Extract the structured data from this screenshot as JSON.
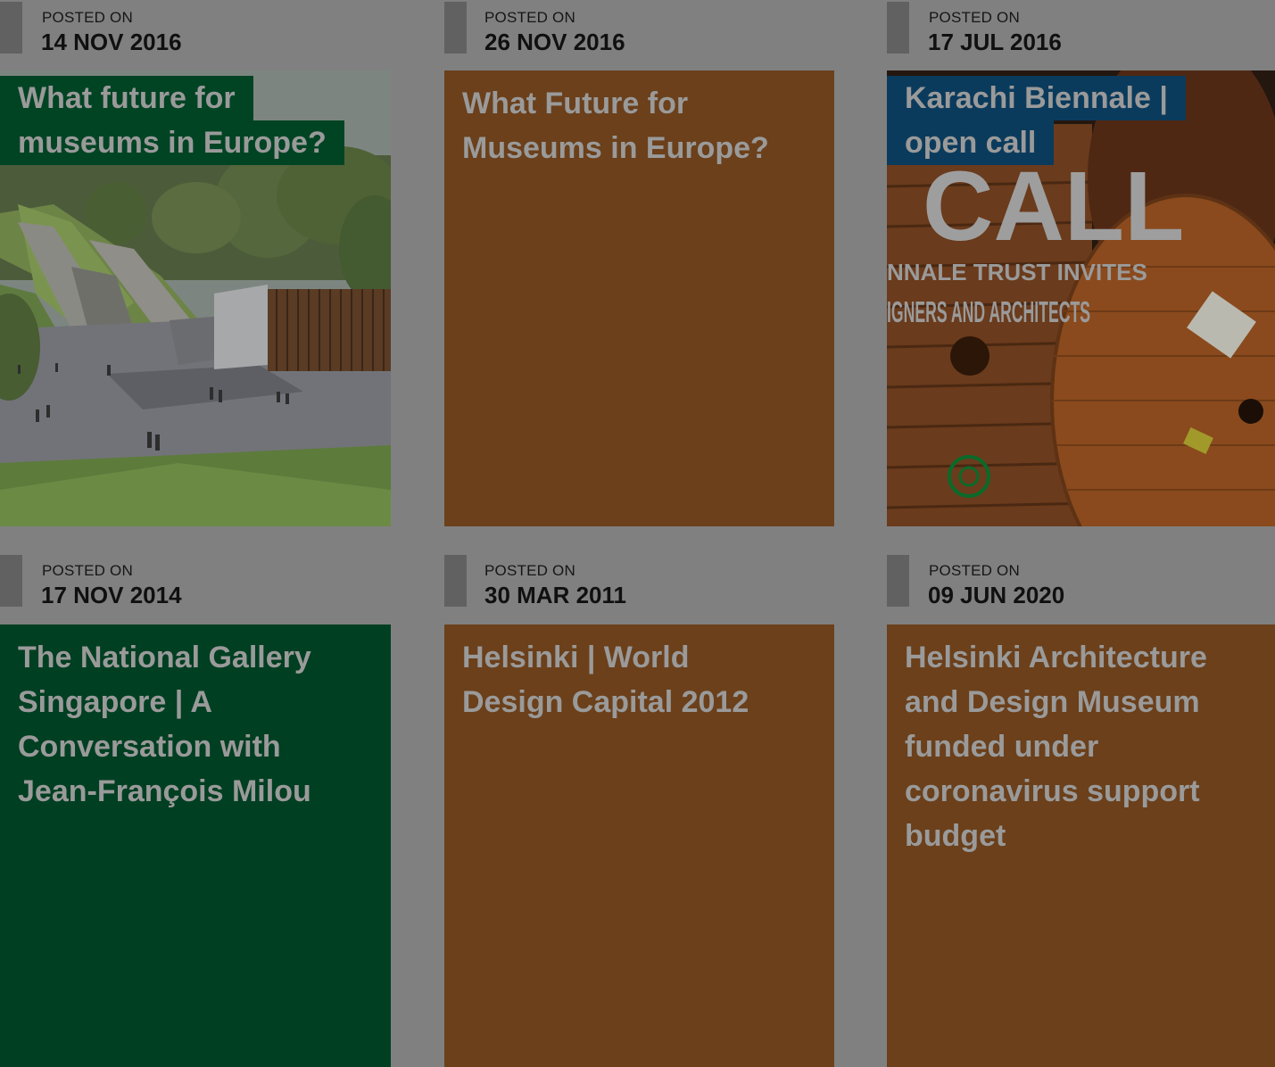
{
  "posts": [
    {
      "label": "POSTED ON",
      "date": "14 NOV 2016",
      "title_lines": [
        "What future for",
        "museums in Europe?"
      ],
      "style": "image-green",
      "image": "park-landscape-rendering"
    },
    {
      "label": "POSTED ON",
      "date": "26 NOV 2016",
      "title": "What Future for Museums in Europe?",
      "style": "orange",
      "color": "#6b401b"
    },
    {
      "label": "POSTED ON",
      "date": "17 JUL 2016",
      "title_lines": [
        "Karachi Biennale |",
        "open call"
      ],
      "style": "image-blue",
      "image": "open-call-poster-cable-spools",
      "image_text": [
        "CALL",
        "NNALE TRUST INVITES",
        "IGNERS AND ARCHITECTS"
      ]
    },
    {
      "label": "POSTED ON",
      "date": "17 NOV 2014",
      "title": "The National Gallery Singapore | A Conversation with Jean-François Milou",
      "style": "green",
      "color": "#003f22"
    },
    {
      "label": "POSTED ON",
      "date": "30 MAR 2011",
      "title": "Helsinki | World Design Capital 2012",
      "style": "orange",
      "color": "#6b401b"
    },
    {
      "label": "POSTED ON",
      "date": "09 JUN 2020",
      "title": "Helsinki Architecture and Design Museum funded under coronavirus support budget",
      "style": "orange",
      "color": "#6b401b"
    }
  ],
  "overlay_color": "#808080"
}
